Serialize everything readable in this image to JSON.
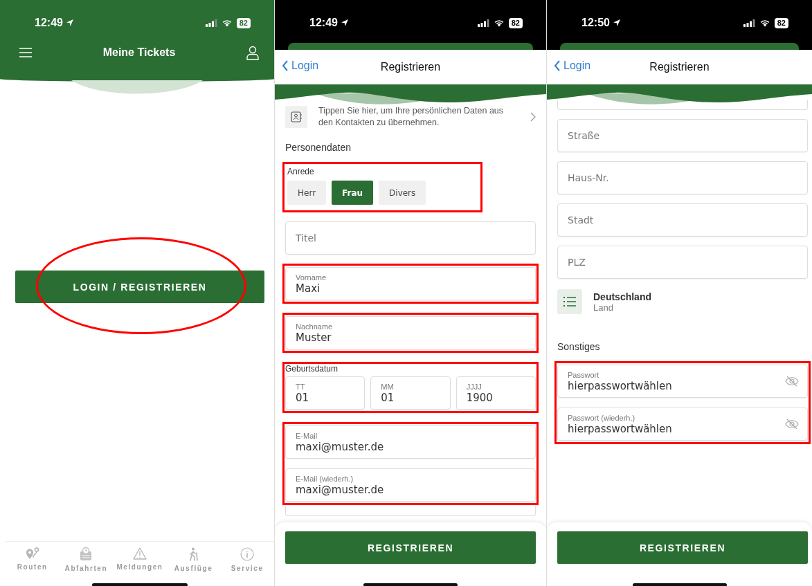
{
  "screens": [
    {
      "kind": "tickets",
      "status_bar": {
        "time": "12:49",
        "battery": "82"
      },
      "header": {
        "title": "Meine Tickets"
      },
      "login_button": {
        "label": "LOGIN / REGISTRIEREN",
        "highlighted": true
      },
      "tab_bar": [
        {
          "kind": "routes",
          "label": "Routen"
        },
        {
          "kind": "departures",
          "label": "Abfahrten"
        },
        {
          "kind": "alerts",
          "label": "Meldungen"
        },
        {
          "kind": "trips",
          "label": "Ausflüge"
        },
        {
          "kind": "service",
          "label": "Service"
        }
      ]
    },
    {
      "kind": "register",
      "status_bar": {
        "time": "12:49",
        "battery": "82"
      },
      "nav": {
        "back": "Login",
        "title": "Registrieren"
      },
      "items": [
        {
          "kind": "contact_row",
          "text": "Tippen Sie hier, um Ihre persönlichen Daten aus den Kontakten zu übernehmen."
        },
        {
          "kind": "section",
          "text": "Personendaten"
        },
        {
          "kind": "segmented",
          "label": "Anrede",
          "highlighted": true,
          "options": [
            {
              "label": "Herr",
              "selected": false
            },
            {
              "label": "Frau",
              "selected": true
            },
            {
              "label": "Divers",
              "selected": false
            }
          ]
        },
        {
          "kind": "group",
          "highlighted": false,
          "fields": [
            {
              "placeholder": "Titel",
              "secure": false
            }
          ]
        },
        {
          "kind": "group",
          "highlighted": true,
          "fields": [
            {
              "label": "Vorname",
              "value": "Maxi",
              "secure": false
            }
          ]
        },
        {
          "kind": "group",
          "highlighted": true,
          "fields": [
            {
              "label": "Nachname",
              "value": "Muster",
              "secure": false
            }
          ]
        },
        {
          "kind": "date",
          "label": "Geburtsdatum",
          "highlighted": true,
          "parts": [
            {
              "label": "TT",
              "value": "01"
            },
            {
              "label": "MM",
              "value": "01"
            },
            {
              "label": "JJJJ",
              "value": "1900"
            }
          ]
        },
        {
          "kind": "group",
          "highlighted": true,
          "fields": [
            {
              "label": "E-Mail",
              "value": "maxi@muster.de",
              "secure": false
            },
            {
              "label": "E-Mail (wiederh.)",
              "value": "maxi@muster.de",
              "secure": false
            }
          ]
        },
        {
          "kind": "partial_field"
        }
      ],
      "submit": "REGISTRIEREN"
    },
    {
      "kind": "register",
      "status_bar": {
        "time": "12:50",
        "battery": "82"
      },
      "nav": {
        "back": "Login",
        "title": "Registrieren"
      },
      "items": [
        {
          "kind": "partial_field"
        },
        {
          "kind": "group",
          "highlighted": false,
          "fields": [
            {
              "placeholder": "Straße",
              "secure": false
            }
          ]
        },
        {
          "kind": "group",
          "highlighted": false,
          "fields": [
            {
              "placeholder": "Haus-Nr.",
              "secure": false
            }
          ]
        },
        {
          "kind": "group",
          "highlighted": false,
          "fields": [
            {
              "placeholder": "Stadt",
              "secure": false
            }
          ]
        },
        {
          "kind": "group",
          "highlighted": false,
          "fields": [
            {
              "placeholder": "PLZ",
              "secure": false
            }
          ]
        },
        {
          "kind": "picker",
          "value": "Deutschland",
          "label": "Land"
        },
        {
          "kind": "section",
          "text": "Sonstiges"
        },
        {
          "kind": "group",
          "highlighted": true,
          "fields": [
            {
              "label": "Passwort",
              "value": "hierpasswortwählen",
              "secure": true
            },
            {
              "label": "Passwort (wiederh.)",
              "value": "hierpasswortwählen",
              "secure": true
            }
          ]
        }
      ],
      "submit": "REGISTRIEREN"
    }
  ]
}
